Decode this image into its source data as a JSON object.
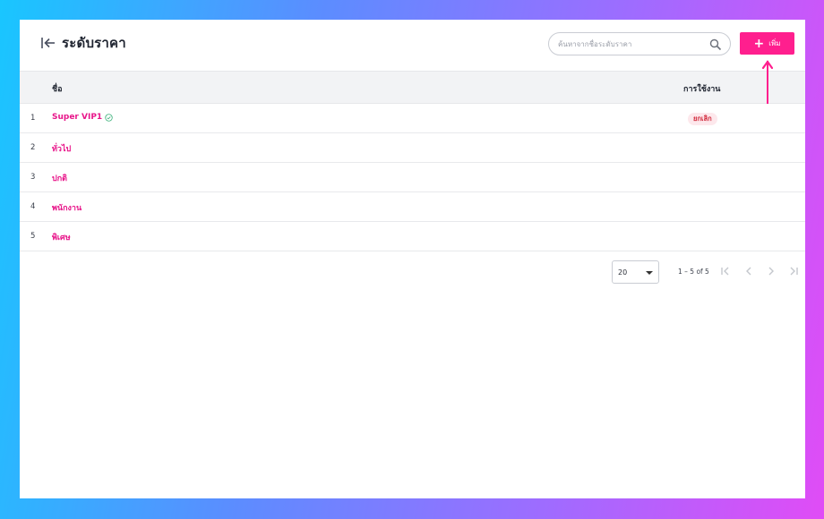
{
  "header": {
    "title": "ระดับราคา",
    "search_placeholder": "ค้นหาจากชื่อระดับราคา",
    "add_label": "เพิ่ม"
  },
  "table": {
    "columns": {
      "name": "ชื่อ",
      "usage": "การใช้งาน"
    },
    "rows": [
      {
        "num": "1",
        "name": "Super VIP1",
        "verified": true,
        "status": "ยกเลิก"
      },
      {
        "num": "2",
        "name": "ทั่วไป",
        "status": ""
      },
      {
        "num": "3",
        "name": "ปกติ",
        "status": ""
      },
      {
        "num": "4",
        "name": "พนักงาน",
        "status": ""
      },
      {
        "num": "5",
        "name": "พิเศษ",
        "status": ""
      }
    ]
  },
  "pagination": {
    "page_size": "20",
    "range": "1 – 5 of 5"
  },
  "colors": {
    "accent": "#ff1f8e",
    "link": "#e8168a",
    "badge_bg": "#fde8ec",
    "badge_text": "#d12a3c"
  },
  "icons": [
    "back-to-start-icon",
    "search-icon",
    "plus-icon",
    "check-circle-icon",
    "dropdown-icon",
    "first-page-icon",
    "prev-page-icon",
    "next-page-icon",
    "last-page-icon",
    "arrow-up-icon"
  ]
}
